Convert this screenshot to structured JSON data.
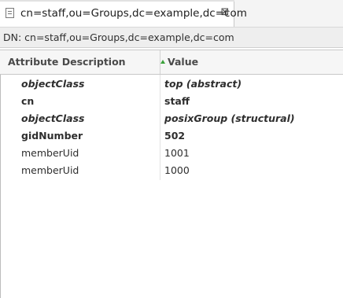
{
  "tab": {
    "title": "cn=staff,ou=Groups,dc=example,dc=com",
    "close_glyph": "⊠"
  },
  "dn_bar": {
    "text": "DN: cn=staff,ou=Groups,dc=example,dc=com"
  },
  "table": {
    "columns": {
      "attribute": "Attribute Description",
      "value": "Value"
    },
    "rows": [
      {
        "attribute": "objectClass",
        "value": "top (abstract)",
        "style": "bold-italic"
      },
      {
        "attribute": "cn",
        "value": "staff",
        "style": "bold"
      },
      {
        "attribute": "objectClass",
        "value": "posixGroup (structural)",
        "style": "bold-italic"
      },
      {
        "attribute": "gidNumber",
        "value": "502",
        "style": "bold"
      },
      {
        "attribute": "memberUid",
        "value": "1001",
        "style": "normal"
      },
      {
        "attribute": "memberUid",
        "value": "1000",
        "style": "normal"
      }
    ]
  },
  "colors": {
    "sort_indicator": "#3aa13a"
  }
}
